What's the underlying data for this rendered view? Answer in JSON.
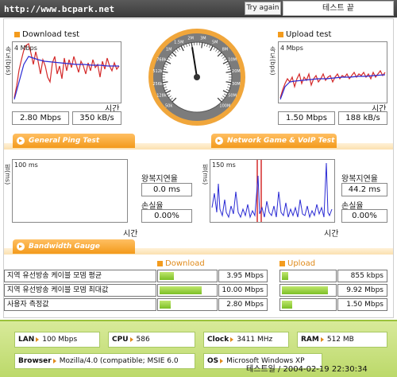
{
  "header": {
    "url": "http://www.bcpark.net",
    "try_again_label": "Try again",
    "end_label": "테스트 끝"
  },
  "download": {
    "title": "Download test",
    "ylabel": "속도(bps)",
    "scale": "4 Mbps",
    "xlabel": "시간",
    "mbps": "2.80 Mbps",
    "kbs": "350 kB/s"
  },
  "upload": {
    "title": "Upload test",
    "ylabel": "속도(bps)",
    "scale": "4 Mbps",
    "xlabel": "시간",
    "mbps": "1.50 Mbps",
    "kbs": "188 kB/s"
  },
  "gauge": {
    "labels": [
      "50k",
      "128k",
      "256k",
      "512k",
      "768k",
      "1M",
      "1.5M",
      "2M",
      "3M",
      "5M",
      "8M",
      "10M",
      "20M",
      "30M",
      "50M",
      "100M"
    ],
    "needle_value": "2M"
  },
  "tabs": {
    "ping": "General Ping Test",
    "game": "Network Game & VoIP Test",
    "bandwidth": "Bandwidth Gauge"
  },
  "ping": {
    "ylabel": "핑(ms)",
    "scale": "100 ms",
    "xlabel": "시간",
    "rtt_label": "왕복지연율",
    "rtt_value": "0.0 ms",
    "loss_label": "손실율",
    "loss_value": "0.00%"
  },
  "game": {
    "ylabel": "핑(ms)",
    "scale": "150 ms",
    "xlabel": "시간",
    "rtt_label": "왕복지연율",
    "rtt_value": "44.2 ms",
    "loss_label": "손실율",
    "loss_value": "0.00%"
  },
  "bandwidth": {
    "download_header": "Download",
    "upload_header": "Upload",
    "rows": [
      {
        "label": "지역 유선방송 케이블 모뎀 평균",
        "download": "3.95 Mbps",
        "download_fill": 0.27,
        "upload": "855 kbps",
        "upload_fill": 0.12
      },
      {
        "label": "지역 유선방송 케이블 모뎀 최대값",
        "download": "10.00 Mbps",
        "download_fill": 0.78,
        "upload": "9.92 Mbps",
        "upload_fill": 0.9
      },
      {
        "label": "사용자 측정값",
        "download": "2.80 Mbps",
        "download_fill": 0.2,
        "upload": "1.50 Mbps",
        "upload_fill": 0.2
      }
    ]
  },
  "specs": {
    "lan_label": "LAN",
    "lan_value": "100 Mbps",
    "cpu_label": "CPU",
    "cpu_value": "586",
    "clock_label": "Clock",
    "clock_value": "3411 MHz",
    "ram_label": "RAM",
    "ram_value": "512 MB",
    "browser_label": "Browser",
    "browser_value": "Mozilla/4.0 (compatible; MSIE 6.0",
    "os_label": "OS",
    "os_value": "Microsoft Windows XP"
  },
  "timestamp": "테스트일 / 2004-02-19 22:30:34",
  "colors": {
    "accent": "#f39a1b",
    "download_line": "#d42a2a",
    "average_line": "#2a2ad4",
    "bar_fill": "#7cbf26",
    "footer_bg": "#c8e07e"
  }
}
